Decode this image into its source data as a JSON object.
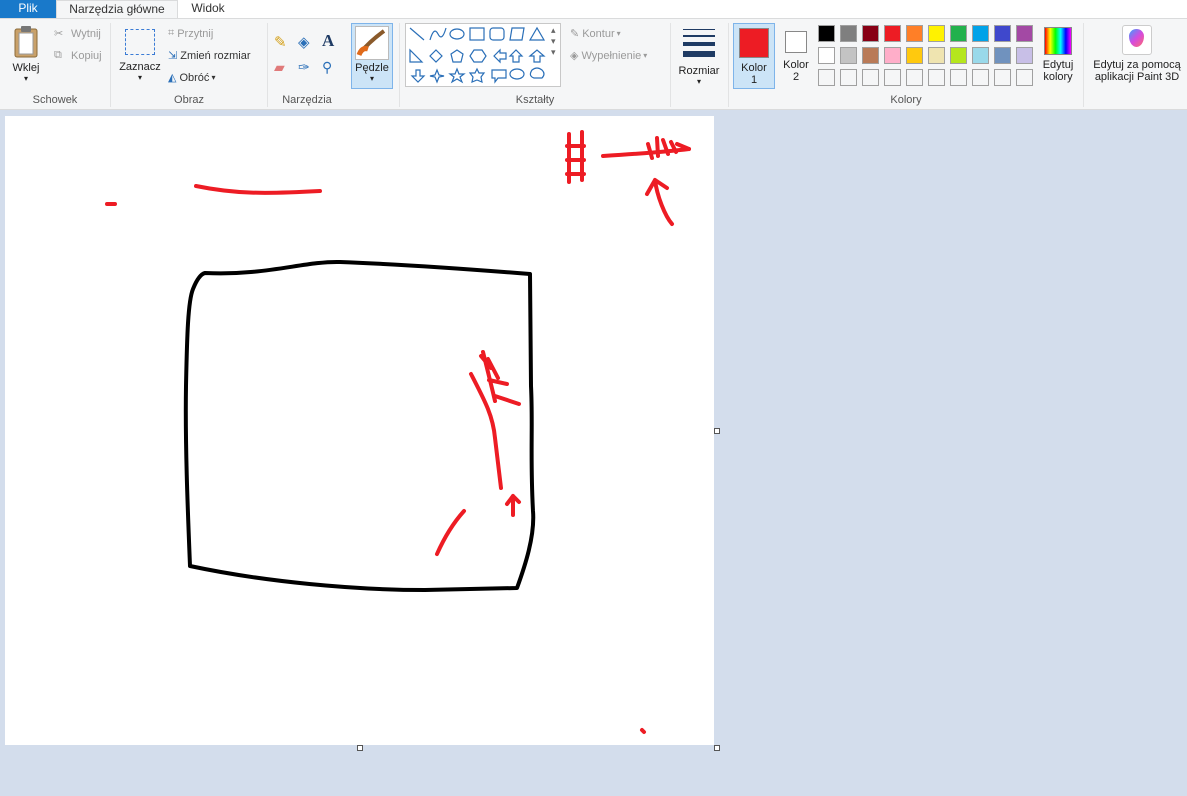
{
  "tabs": {
    "file": "Plik",
    "home": "Narzędzia główne",
    "view": "Widok"
  },
  "clipboard": {
    "paste": "Wklej",
    "cut": "Wytnij",
    "copy": "Kopiuj",
    "group": "Schowek"
  },
  "image": {
    "select": "Zaznacz",
    "crop": "Przytnij",
    "resize": "Zmień rozmiar",
    "rotate": "Obróć",
    "group": "Obraz"
  },
  "tools": {
    "group": "Narzędzia"
  },
  "brushes": {
    "label": "Pędzle"
  },
  "shapes": {
    "group": "Kształty",
    "outline": "Kontur",
    "fill": "Wypełnienie"
  },
  "size": {
    "label": "Rozmiar"
  },
  "colors": {
    "color1_line1": "Kolor",
    "color1_line2": "1",
    "color2_line1": "Kolor",
    "color2_line2": "2",
    "edit_line1": "Edytuj",
    "edit_line2": "kolory",
    "group": "Kolory",
    "color1": "#ed1c24",
    "color2": "#ffffff",
    "palette_row1": [
      "#000000",
      "#7f7f7f",
      "#880015",
      "#ed1c24",
      "#ff7f27",
      "#fff200",
      "#22b14c",
      "#00a2e8",
      "#3f48cc",
      "#a349a4"
    ],
    "palette_row2": [
      "#ffffff",
      "#c3c3c3",
      "#b97a57",
      "#ffaec9",
      "#ffc90e",
      "#efe4b0",
      "#b5e61d",
      "#99d9ea",
      "#7092be",
      "#c8bfe7"
    ]
  },
  "paint3d": {
    "line1": "Edytuj za pomocą",
    "line2": "aplikacji Paint 3D"
  }
}
